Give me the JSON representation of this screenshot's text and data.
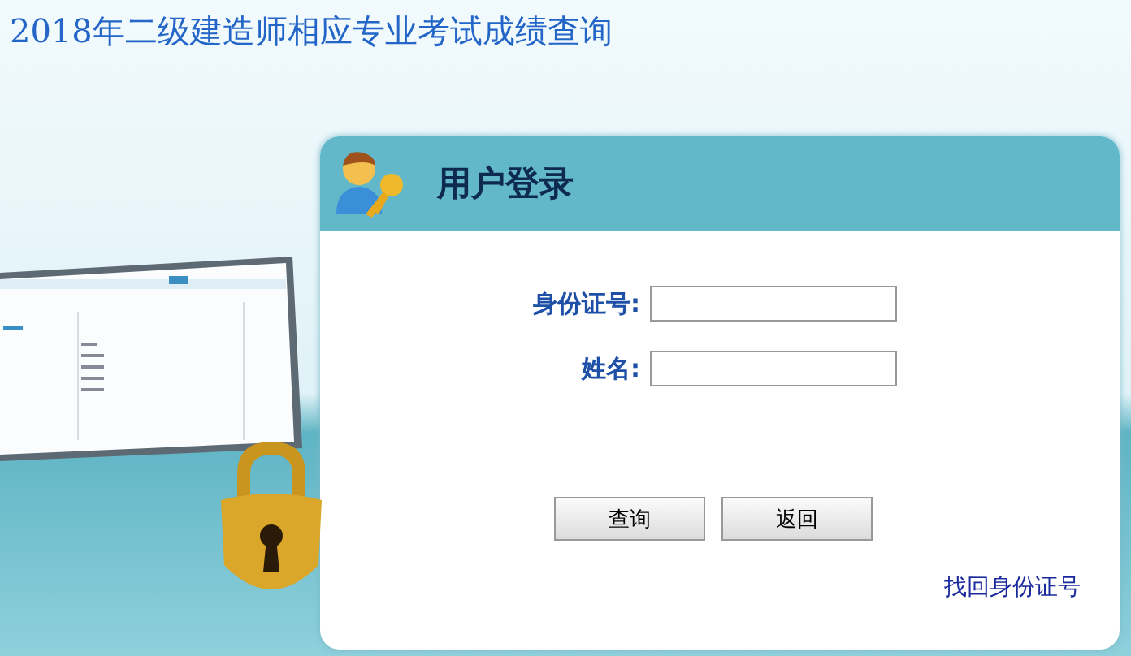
{
  "page_title": "2018年二级建造师相应专业考试成绩查询",
  "login_panel": {
    "title": "用户登录",
    "fields": [
      {
        "label": "身份证号:"
      },
      {
        "label": "姓名:"
      }
    ],
    "buttons": [
      "查询",
      "返回"
    ],
    "link": "找回身份证号"
  }
}
